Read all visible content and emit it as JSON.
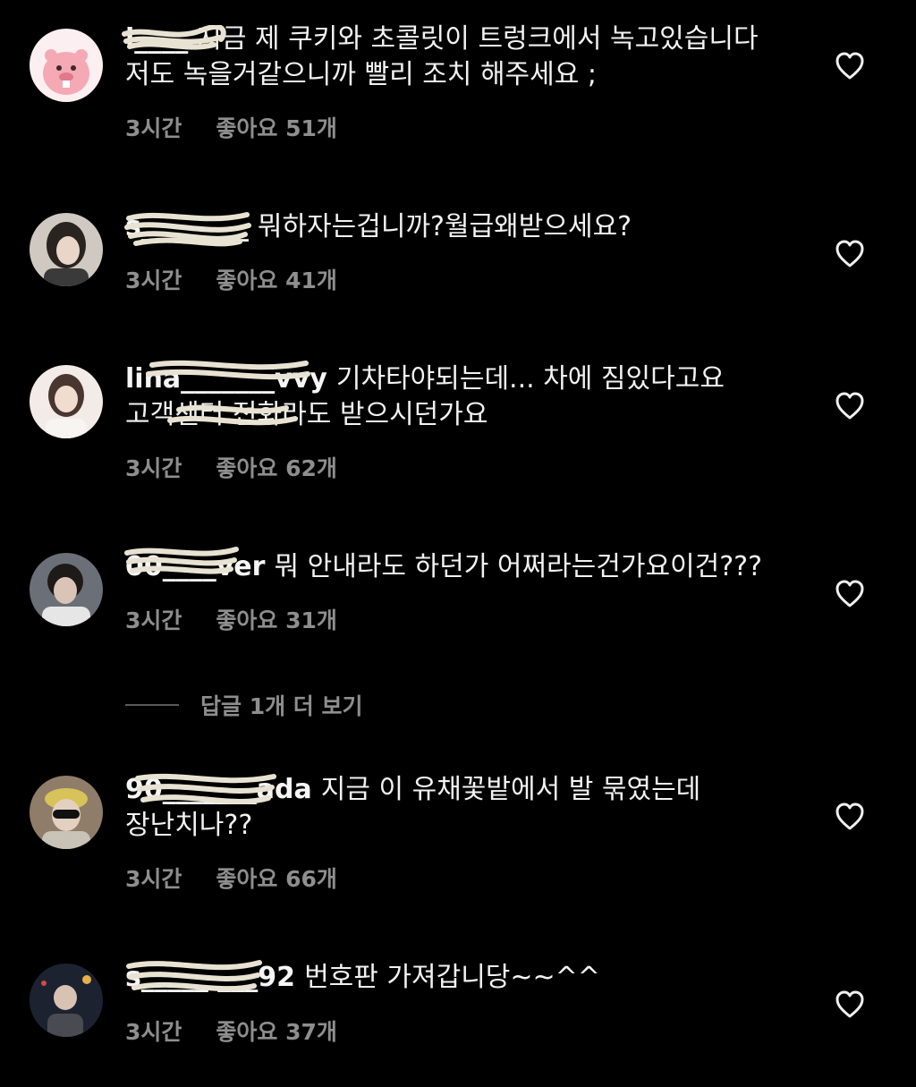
{
  "comments": [
    {
      "username": "l____",
      "text": "지금 제 쿠키와 초콜릿이 트렁크에서 녹고있습니다 저도 녹을거같으니까 빨리 조치 해주세요 ;",
      "time": "3시간",
      "likes": "좋아요 51개",
      "avatar": "beaver-character-avatar"
    },
    {
      "username": "s________",
      "text": "뭐하자는겁니까?월급왜받으세요?",
      "time": "3시간",
      "likes": "좋아요 41개",
      "avatar": "person-photo-avatar"
    },
    {
      "username": "lina_______vvy",
      "text": "기차타야되는데... 차에 짐있다고요 고객센터 전화라도 받으시던가요",
      "time": "3시간",
      "likes": "좋아요 62개",
      "avatar": "person-photo-avatar"
    },
    {
      "username": "00____ver",
      "text": "뭐 안내라도 하던가 어쩌라는건가요이건???",
      "time": "3시간",
      "likes": "좋아요 31개",
      "avatar": "person-photo-avatar"
    },
    {
      "username": "90_______ada",
      "text": "지금 이 유채꽃밭에서 발 묶였는데 장난치나??",
      "time": "3시간",
      "likes": "좋아요 66개",
      "avatar": "person-photo-avatar"
    },
    {
      "username": "s_____ ___92",
      "text": "번호판 가져갑니당~~^^",
      "time": "3시간",
      "likes": "좋아요 37개",
      "avatar": "person-photo-avatar"
    }
  ],
  "replies_toggle": {
    "label": "답글 1개 더 보기"
  },
  "colors": {
    "background": "#000000",
    "text": "#f2f2f2",
    "meta": "#8e8e8e",
    "redaction": "#e8e2d2"
  },
  "icons": {
    "like": "heart-outline-icon"
  }
}
